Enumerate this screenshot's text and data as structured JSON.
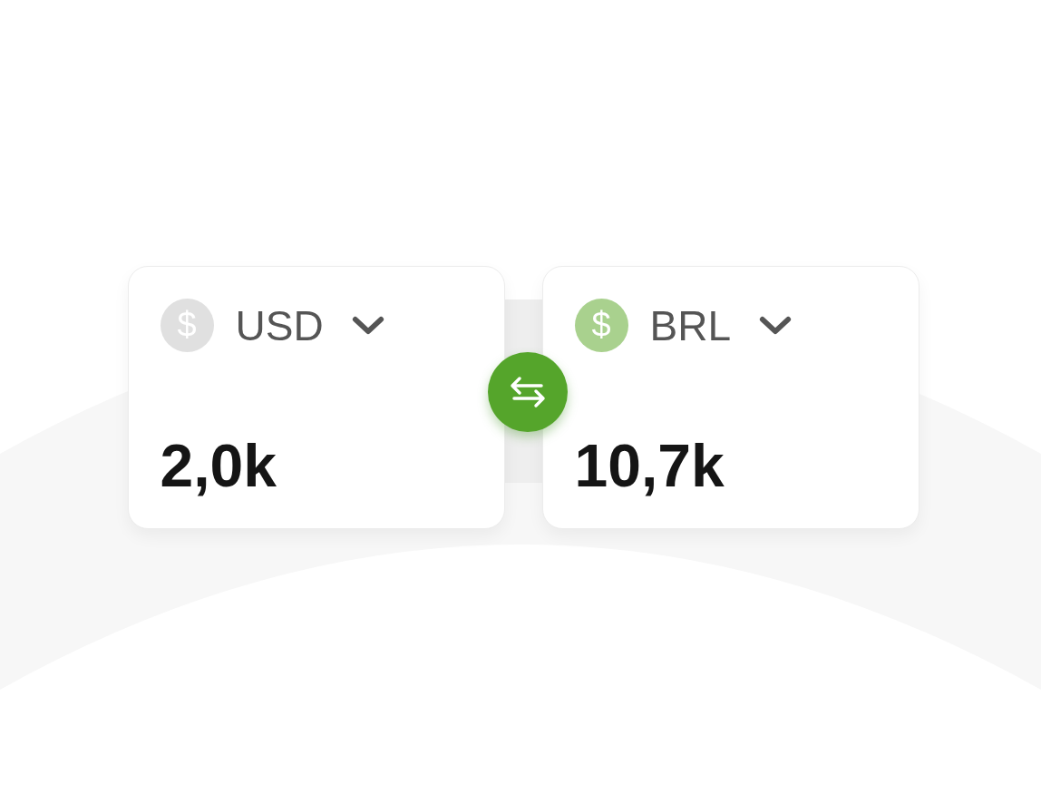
{
  "cards": [
    {
      "currency": "USD",
      "symbol": "$",
      "color": "#e0e0e0",
      "amount": "2,0k"
    },
    {
      "currency": "BRL",
      "symbol": "$",
      "color": "#a9d18e",
      "amount": "10,7k"
    }
  ]
}
